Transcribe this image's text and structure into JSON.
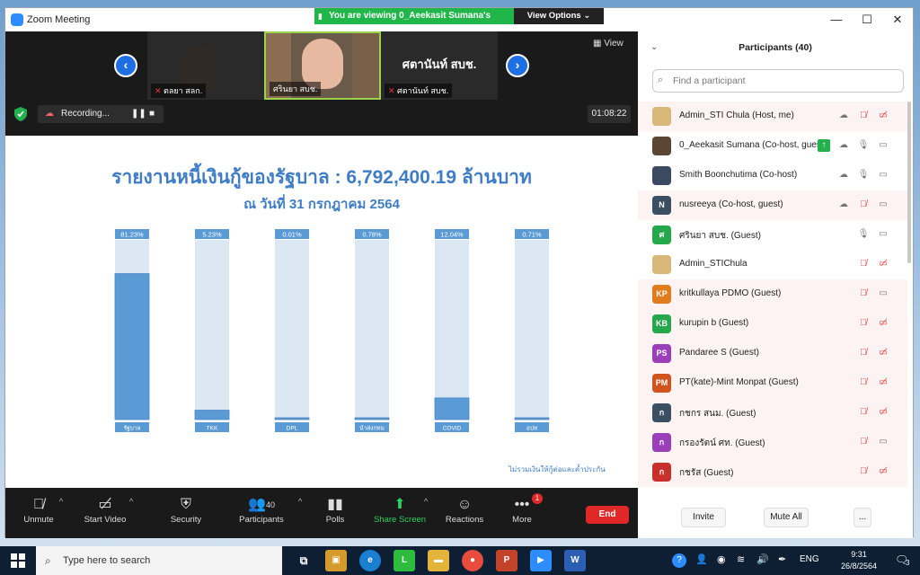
{
  "window": {
    "title": "Zoom Meeting",
    "viewing_banner": "You are viewing 0_Aeekasit Sumana's screen",
    "view_options": "View Options",
    "minimize": "—",
    "maximize": "☐",
    "close": "✕"
  },
  "video_strip": {
    "view_label": "View",
    "tiles": [
      {
        "name": "ตลยา สลก."
      },
      {
        "name": "ศรินยา สบช."
      },
      {
        "name": "ศตานันท์ สบช.",
        "display": "ศตานันท์ สบช."
      }
    ]
  },
  "recording": {
    "label": "Recording...",
    "timer": "01:08:22"
  },
  "slide": {
    "title": "รายงานหนี้เงินกู้ของรัฐบาล : 6,792,400.19 ล้านบาท",
    "subtitle": "ณ วันที่ 31 กรกฎาคม 2564",
    "note": "ไม่รวมเงินให้กู้ต่อและค้ำประกัน"
  },
  "chart_data": {
    "type": "bar",
    "categories": [
      "รัฐบาล",
      "TKK",
      "DPL",
      "นำส่งกทม",
      "COVID",
      "อปท"
    ],
    "values": [
      81.23,
      5.23,
      0.01,
      0.78,
      12.04,
      0.71
    ],
    "data_labels": [
      "81.23%",
      "5.23%",
      "0.01%",
      "0.78%",
      "12.04%",
      "0.71%"
    ],
    "ylim": [
      0,
      100
    ],
    "colors": {
      "bar": "#5b9bd5",
      "track": "#dce7f4",
      "label_bg": "#5b9bd5"
    }
  },
  "toolbar": {
    "unmute": "Unmute",
    "start_video": "Start Video",
    "security": "Security",
    "participants": "Participants",
    "participants_count": "40",
    "polls": "Polls",
    "share_screen": "Share Screen",
    "reactions": "Reactions",
    "more": "More",
    "more_badge": "1",
    "end": "End"
  },
  "panel": {
    "title": "Participants (40)",
    "search_placeholder": "Find a participant",
    "participants": [
      {
        "name": "Admin_STI Chula (Host, me)",
        "initials": "",
        "color": "#d8b878",
        "mic": "off",
        "video": "off",
        "alt": true
      },
      {
        "name": "0_Aeekasit Sumana (Co-host, guest)",
        "initials": "",
        "color": "#5a4632",
        "mic": "on",
        "video": "on",
        "sharing": true,
        "alt": false
      },
      {
        "name": "Smith Boonchutima (Co-host)",
        "initials": "",
        "color": "#3b4a60",
        "mic": "on",
        "video": "on",
        "alt": false
      },
      {
        "name": "nusreeya (Co-host, guest)",
        "initials": "N",
        "color": "#3b4f63",
        "mic": "off",
        "video": "on",
        "alt": true
      },
      {
        "name": "ศรินยา สบช. (Guest)",
        "initials": "ศ",
        "color": "#25a84c",
        "mic": "on",
        "video": "on",
        "alt": false
      },
      {
        "name": "Admin_STIChula",
        "initials": "",
        "color": "#d8b878",
        "mic": "off",
        "video": "off",
        "alt": false
      },
      {
        "name": "kritkullaya PDMO (Guest)",
        "initials": "KP",
        "color": "#e27b1c",
        "mic": "off",
        "video": "on",
        "alt": true
      },
      {
        "name": "kurupin b (Guest)",
        "initials": "KB",
        "color": "#25a84c",
        "mic": "off",
        "video": "off",
        "alt": true
      },
      {
        "name": "Pandaree S (Guest)",
        "initials": "PS",
        "color": "#9a3fb8",
        "mic": "off",
        "video": "off",
        "alt": true
      },
      {
        "name": "PT(kate)-Mint Monpat (Guest)",
        "initials": "PM",
        "color": "#d1531d",
        "mic": "off",
        "video": "off",
        "alt": true
      },
      {
        "name": "กชกร สนม. (Guest)",
        "initials": "ก",
        "color": "#3b4f63",
        "mic": "off",
        "video": "off",
        "alt": true
      },
      {
        "name": "กรองรัตน์ ศท. (Guest)",
        "initials": "ก",
        "color": "#9a3fb8",
        "mic": "off",
        "video": "on",
        "alt": true
      },
      {
        "name": "กชรัส (Guest)",
        "initials": "ก",
        "color": "#c9302c",
        "mic": "off",
        "video": "off",
        "alt": true
      }
    ],
    "invite": "Invite",
    "mute_all": "Mute All",
    "more": "..."
  },
  "taskbar": {
    "search_placeholder": "Type here to search",
    "lang": "ENG",
    "time": "9:31",
    "date": "26/8/2564",
    "notif_count": "3"
  }
}
